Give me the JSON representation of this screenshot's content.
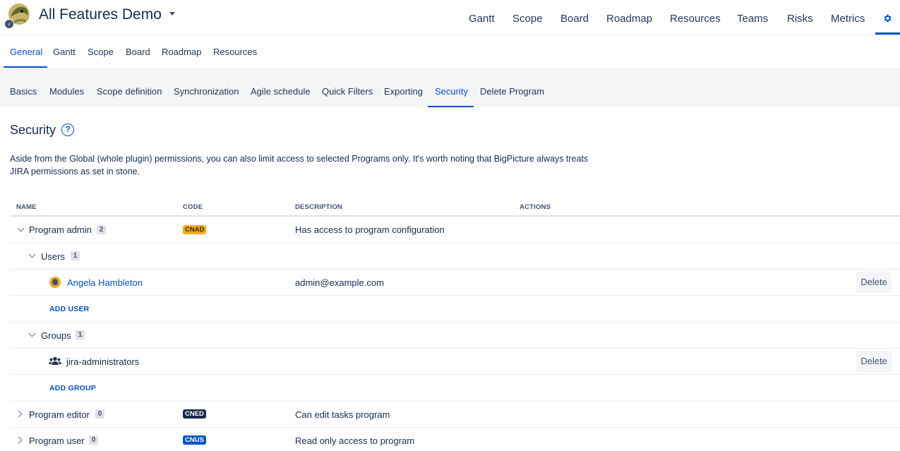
{
  "header": {
    "app_title": "All Features Demo",
    "nav": [
      "Gantt",
      "Scope",
      "Board",
      "Roadmap",
      "Resources",
      "Teams",
      "Risks",
      "Metrics"
    ],
    "gear_icon": "gear-icon",
    "accent_color": "#0052cc"
  },
  "tabs_primary": {
    "items": [
      "General",
      "Gantt",
      "Scope",
      "Board",
      "Roadmap",
      "Resources"
    ],
    "active": "General"
  },
  "tabs_secondary": {
    "items": [
      "Basics",
      "Modules",
      "Scope definition",
      "Synchronization",
      "Agile schedule",
      "Quick Filters",
      "Exporting",
      "Security",
      "Delete Program"
    ],
    "active": "Security"
  },
  "section": {
    "title": "Security",
    "help_icon": "?",
    "description": "Aside from the Global (whole plugin) permissions, you can also limit access to selected Programs only. It's worth noting that BigPicture always treats JIRA permissions as set in stone."
  },
  "table": {
    "headers": [
      "NAME",
      "CODE",
      "DESCRIPTION",
      "ACTIONS"
    ],
    "roles": [
      {
        "name": "Program admin",
        "count": "2",
        "code": "CNAD",
        "code_color": "#ffab00",
        "description": "Has access to program configuration",
        "expanded": true
      },
      {
        "name": "Program editor",
        "count": "0",
        "code": "CNED",
        "code_color": "#172b4d",
        "description": "Can edit tasks program",
        "expanded": false
      },
      {
        "name": "Program user",
        "count": "0",
        "code": "CNUS",
        "code_color": "#0052cc",
        "description": "Read only access to program",
        "expanded": false
      }
    ],
    "users_group": {
      "label": "Users",
      "count": "1"
    },
    "user": {
      "name": "Angela Hambleton",
      "email": "admin@example.com",
      "delete_label": "Delete"
    },
    "add_user_label": "ADD USER",
    "groups_group": {
      "label": "Groups",
      "count": "1"
    },
    "group": {
      "name": "jira-administrators",
      "delete_label": "Delete"
    },
    "add_group_label": "ADD GROUP"
  }
}
